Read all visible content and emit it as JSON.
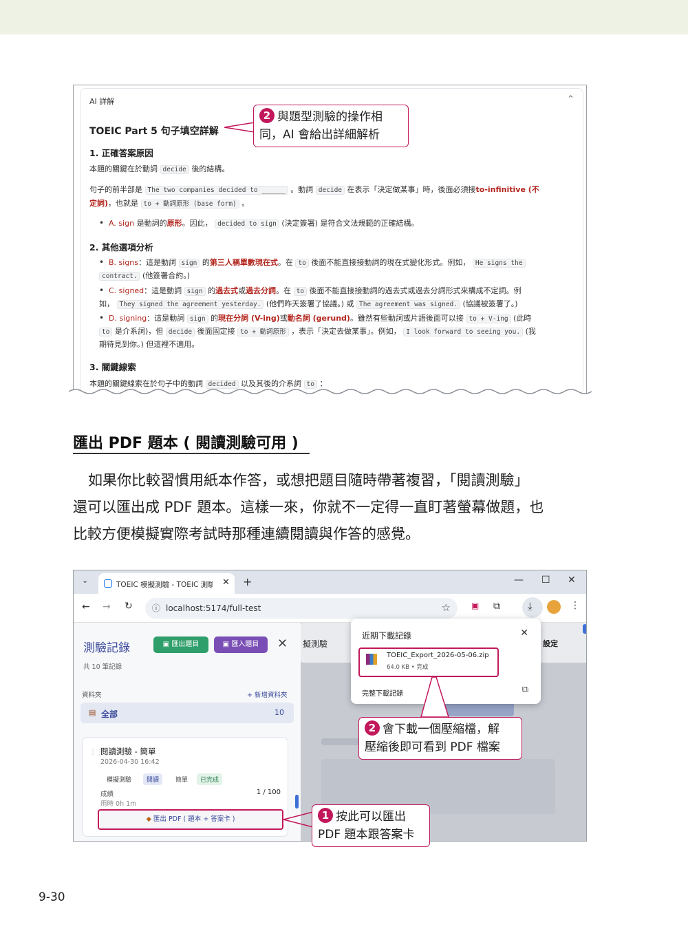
{
  "shot1": {
    "header": "AI 詳解",
    "collapse_icon": "chevron-up-icon",
    "title": "TOEIC Part 5 句子填空詳解",
    "s1_heading": "1. 正確答案原因",
    "s1_p1_a": "本題的關鍵在於動詞",
    "s1_p1_code": "decide",
    "s1_p1_b": "後的結構。",
    "s1_p2_a": "句子的前半部是",
    "s1_p2_code1": "The two companies decided to ______",
    "s1_p2_b": "。動詞",
    "s1_p2_code2": "decide",
    "s1_p2_c": "在表示「決定做某事」時，後面必須接",
    "s1_p2_red": "to-infinitive (不",
    "s1_p3_red": "定詞)",
    "s1_p3_a": "，也就是",
    "s1_p3_code": "to + 動詞原形 (base form)",
    "s1_p3_b": "。",
    "s1_b1_red": "A. sign",
    "s1_b1_a": " 是動詞的",
    "s1_b1_redb": "原形",
    "s1_b1_b": "。因此，",
    "s1_b1_code": "decided to sign",
    "s1_b1_c": "(決定簽署) 是符合文法規範的正確結構。",
    "s2_heading": "2. 其他選項分析",
    "b2_red": "B. signs",
    "b2_a": "：這是動詞",
    "b2_code1": "sign",
    "b2_b": "的",
    "b2_redb": "第三人稱單數現在式",
    "b2_c": "。在",
    "b2_code2": "to",
    "b2_d": "後面不能直接接動詞的現在式變化形式。例如，",
    "b2_code3": "He signs the",
    "b2_code4": "contract.",
    "b2_e": "(他簽署合約。)",
    "c2_red": "C. signed",
    "c2_a": "：這是動詞",
    "c2_code1": "sign",
    "c2_b": "的",
    "c2_redb1": "過去式",
    "c2_c": "或",
    "c2_redb2": "過去分詞",
    "c2_d": "。在",
    "c2_code2": "to",
    "c2_e": "後面不能直接接動詞的過去式或過去分詞形式來構成不定詞。例",
    "c2_f": "如，",
    "c2_code3": "They signed the agreement yesterday.",
    "c2_g": "(他們昨天簽署了協議。) 或",
    "c2_code4": "The agreement was signed.",
    "c2_h": "(協議被簽署了。)",
    "d2_red": "D. signing",
    "d2_a": "：這是動詞",
    "d2_code1": "sign",
    "d2_b": "的",
    "d2_redb1": "現在分詞 (V-ing)",
    "d2_c": "或",
    "d2_redb2": "動名詞 (gerund)",
    "d2_d": "。雖然有些動詞或片語後面可以接",
    "d2_code2": "to + V-ing",
    "d2_e": "(此時",
    "d2_code3": "to",
    "d2_f": "是介系詞)，但",
    "d2_code4": "decide",
    "d2_g": "後面固定接",
    "d2_code5": "to + 動詞原形",
    "d2_h": "，表示「決定去做某事」。例如，",
    "d2_code6": "I look forward to seeing you.",
    "d2_i": "(我",
    "d2_j": "期待見到你。) 但這裡不適用。",
    "s3_heading": "3. 關鍵線索",
    "s3_p_a": "本題的關鍵線索在於句子中的動詞",
    "s3_p_code1": "decided",
    "s3_p_b": "以及其後的介系詞",
    "s3_p_code2": "to",
    "s3_p_c": "："
  },
  "callout1": {
    "number": "2",
    "line1": "與題型測驗的操作相",
    "line2": "同，AI 會給出詳細解析"
  },
  "section": {
    "title": "匯出 PDF 題本 ( 閱讀測驗可用 )",
    "para1": "如果你比較習慣用紙本作答，或想把題目隨時帶著複習，「閱讀測驗」",
    "para2": "還可以匯出成 PDF 題本。這樣一來，你就不一定得一直盯著螢幕做題，也",
    "para3": "比較方便模擬實際考試時那種連續閱讀與作答的感覺。"
  },
  "browser": {
    "tab_title": "TOEIC 模擬測驗 - TOEIC 測驗",
    "url": "localhost:5174/full-test",
    "panel_title": "測驗記錄",
    "export_btn": "匯出題目",
    "import_btn": "匯入題目",
    "record_count": "共 10 筆記錄",
    "folder_label": "資料夾",
    "new_folder": "+ 新增資料夾",
    "all_label": "全部",
    "all_count": "10",
    "card_title": "閱讀測驗 - 簡單",
    "card_date": "2026-04-30 16:42",
    "tag_mock": "模擬測驗",
    "tag_read": "閱讀",
    "tag_easy": "簡單",
    "tag_done": "已完成",
    "score_label": "成績",
    "score_value": "1 / 100",
    "time_label": "用時 0h 1m",
    "export_pdf": "匯出 PDF ( 題本 + 答案卡 )",
    "right_text1": "擬測驗",
    "right_text2": "設定",
    "downloads_title": "近期下載記錄",
    "file_name": "TOEIC_Export_2026-05-06.zip",
    "file_meta": "64.0 KB • 完成",
    "all_downloads": "完整下載記錄"
  },
  "callout2": {
    "number": "2",
    "line1": "會下載一個壓縮檔，解",
    "line2": "壓縮後即可看到 PDF 檔案"
  },
  "callout3": {
    "number": "1",
    "line1": "按此可以匯出",
    "line2": "PDF 題本跟答案卡"
  },
  "page_number": "9-30",
  "colors": {
    "accent": "#c2185b",
    "green_btn": "#2e9e6a",
    "purple_btn": "#7a4fb5",
    "heading_blue": "#3b4a9c",
    "red_text": "#b3261e"
  }
}
